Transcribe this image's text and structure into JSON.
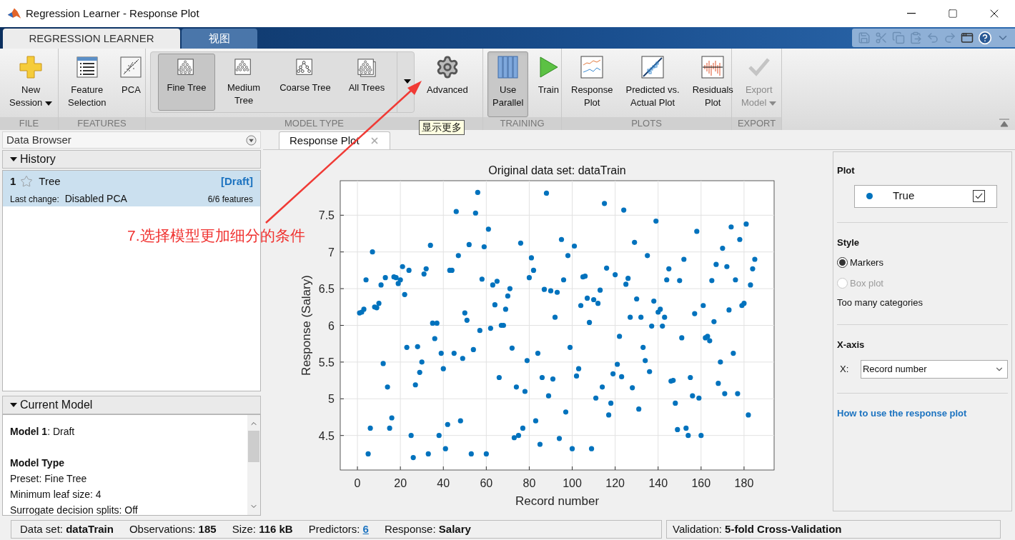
{
  "window": {
    "title": "Regression Learner - Response Plot"
  },
  "ribbon_tabs": [
    {
      "label": "REGRESSION LEARNER",
      "selected": true
    },
    {
      "label": "视图",
      "selected": false
    }
  ],
  "ribbon": {
    "groups": [
      {
        "label": "FILE",
        "items": [
          {
            "label": "New\nSession",
            "dropdown": true
          }
        ]
      },
      {
        "label": "FEATURES",
        "items": [
          {
            "label": "Feature\nSelection"
          },
          {
            "label": "PCA"
          }
        ]
      },
      {
        "label": "MODEL TYPE",
        "gallery": [
          {
            "label": "Fine Tree",
            "selected": true
          },
          {
            "label": "Medium\nTree",
            "selected": false
          },
          {
            "label": "Coarse Tree",
            "selected": false
          },
          {
            "label": "All Trees",
            "selected": false
          }
        ],
        "items": [
          {
            "label": "Advanced"
          }
        ]
      },
      {
        "label": "TRAINING",
        "items": [
          {
            "label": "Use\nParallel",
            "pressed": true
          },
          {
            "label": "Train",
            "pressed": false
          }
        ]
      },
      {
        "label": "PLOTS",
        "items": [
          {
            "label": "Response\nPlot"
          },
          {
            "label": "Predicted vs.\nActual Plot"
          },
          {
            "label": "Residuals\nPlot"
          }
        ]
      },
      {
        "label": "EXPORT",
        "items": [
          {
            "label": "Export\nModel",
            "dropdown": true,
            "disabled": true
          }
        ]
      }
    ]
  },
  "tooltip": {
    "text": "显示更多"
  },
  "annotation": {
    "text": "7.选择模型更加细分的条件"
  },
  "data_browser": {
    "title": "Data Browser",
    "history": {
      "title": "History",
      "expanded": true,
      "models": [
        {
          "number": "1",
          "starred": false,
          "name": "Tree",
          "status": "[Draft]",
          "last_change_label": "Last change:",
          "last_change": "Disabled PCA",
          "features": "6/6 features",
          "selected": true
        }
      ]
    },
    "current_model": {
      "title": "Current Model",
      "expanded": true,
      "lines": [
        {
          "kind": "text",
          "text": "**Model 1**: Draft"
        },
        {
          "kind": "heading",
          "text": "Model Type"
        },
        {
          "kind": "text",
          "text": "Preset: Fine Tree"
        },
        {
          "kind": "text",
          "text": "Minimum leaf size: 4"
        },
        {
          "kind": "text",
          "text": "Surrogate decision splits: Off"
        }
      ]
    }
  },
  "doc_tabs": [
    {
      "label": "Response Plot",
      "selected": true
    }
  ],
  "chart_data": {
    "type": "scatter",
    "grid": true,
    "title": "Original data set: dataTrain",
    "xlabel": "Record number",
    "ylabel": "Response (Salary)",
    "xlim": [
      -8,
      194
    ],
    "ylim": [
      4.03,
      7.97
    ],
    "xticks": [
      0,
      20,
      40,
      60,
      80,
      100,
      120,
      140,
      160,
      180
    ],
    "yticks": [
      4.5,
      5,
      5.5,
      6,
      6.5,
      7,
      7.5
    ],
    "x": [
      1,
      2,
      3,
      4,
      5,
      6,
      7,
      8,
      9,
      10,
      11,
      12,
      13,
      14,
      15,
      16,
      17,
      18,
      19,
      20,
      21,
      22,
      23,
      24,
      25,
      26,
      27,
      28,
      29,
      30,
      31,
      32,
      33,
      34,
      35,
      36,
      37,
      38,
      39,
      40,
      41,
      42,
      43,
      44,
      45,
      46,
      47,
      48,
      49,
      50,
      51,
      52,
      53,
      54,
      55,
      56,
      57,
      58,
      59,
      60,
      61,
      62,
      63,
      64,
      65,
      66,
      67,
      68,
      69,
      70,
      71,
      72,
      73,
      74,
      75,
      76,
      77,
      78,
      79,
      80,
      81,
      82,
      83,
      84,
      85,
      86,
      87,
      88,
      89,
      90,
      91,
      92,
      93,
      94,
      95,
      96,
      97,
      98,
      99,
      100,
      101,
      102,
      103,
      104,
      105,
      106,
      107,
      108,
      109,
      110,
      111,
      112,
      113,
      114,
      115,
      116,
      117,
      118,
      119,
      120,
      121,
      122,
      123,
      124,
      125,
      126,
      127,
      128,
      129,
      130,
      131,
      132,
      133,
      134,
      135,
      136,
      137,
      138,
      139,
      140,
      141,
      142,
      143,
      144,
      145,
      146,
      147,
      148,
      149,
      150,
      151,
      152,
      153,
      154,
      155,
      156,
      157,
      158,
      159,
      160,
      161,
      162,
      163,
      164,
      165,
      166,
      167,
      168,
      169,
      170,
      171,
      172,
      173,
      174,
      175,
      176,
      177,
      178,
      179,
      180,
      181,
      182,
      183,
      184,
      185
    ],
    "series": [
      {
        "name": "True",
        "color": "#0072bd",
        "values": [
          6.17,
          6.18,
          6.22,
          6.62,
          4.25,
          4.6,
          7.0,
          6.25,
          6.24,
          6.3,
          6.55,
          5.48,
          6.65,
          5.16,
          4.6,
          4.74,
          6.66,
          6.65,
          6.57,
          6.62,
          6.8,
          6.42,
          5.7,
          6.75,
          4.5,
          4.2,
          5.19,
          5.71,
          5.36,
          5.5,
          6.7,
          6.77,
          4.25,
          7.09,
          6.03,
          5.82,
          6.03,
          4.5,
          5.62,
          5.41,
          4.32,
          4.65,
          6.75,
          6.75,
          5.62,
          7.55,
          6.95,
          4.7,
          5.55,
          6.17,
          6.07,
          7.1,
          4.25,
          5.67,
          7.53,
          7.81,
          5.93,
          6.63,
          7.07,
          4.25,
          7.31,
          5.96,
          6.55,
          6.28,
          6.6,
          5.29,
          6.0,
          6.0,
          6.22,
          6.4,
          6.5,
          5.69,
          4.47,
          5.16,
          4.5,
          7.12,
          4.6,
          5.1,
          5.52,
          6.65,
          6.92,
          6.75,
          4.7,
          5.62,
          4.38,
          5.29,
          6.49,
          7.8,
          5.04,
          6.47,
          5.27,
          6.11,
          6.45,
          4.46,
          7.17,
          6.62,
          4.82,
          6.95,
          5.7,
          4.32,
          7.08,
          5.31,
          5.41,
          6.27,
          6.66,
          6.67,
          6.37,
          6.04,
          4.32,
          6.35,
          5.01,
          6.3,
          6.48,
          5.16,
          7.66,
          6.78,
          4.78,
          4.94,
          5.34,
          6.69,
          5.47,
          5.85,
          5.3,
          7.57,
          6.56,
          6.64,
          6.11,
          5.15,
          7.13,
          6.36,
          4.86,
          6.11,
          5.7,
          5.52,
          6.95,
          5.37,
          5.99,
          6.33,
          7.42,
          6.18,
          6.22,
          5.99,
          6.11,
          6.62,
          6.77,
          5.24,
          5.25,
          4.94,
          4.58,
          6.61,
          5.83,
          6.9,
          4.6,
          4.5,
          5.29,
          5.04,
          6.16,
          7.28,
          5.01,
          4.5,
          6.27,
          5.83,
          5.85,
          5.79,
          6.61,
          6.05,
          6.83,
          5.21,
          5.5,
          7.05,
          5.07,
          6.8,
          6.21,
          7.34,
          5.62,
          6.62,
          5.07,
          7.17,
          6.27,
          6.3,
          7.38,
          4.78,
          6.55,
          6.77,
          6.9
        ]
      }
    ]
  },
  "options": {
    "plot": {
      "title": "Plot",
      "checked": true
    },
    "style": {
      "title": "Style",
      "options": [
        {
          "label": "Markers",
          "selected": true,
          "disabled": false
        },
        {
          "label": "Box plot",
          "selected": false,
          "disabled": true
        }
      ],
      "note": "Too many categories"
    },
    "x_axis": {
      "title": "X-axis",
      "field_label": "X:",
      "value": "Record number"
    },
    "help_link": "How to use the response plot"
  },
  "status_bar": {
    "items": [
      {
        "label": "Data set: ",
        "value": "dataTrain",
        "kind": "bold"
      },
      {
        "label": "Observations: ",
        "value": "185",
        "kind": "bold"
      },
      {
        "label": "Size: ",
        "value": "116 kB",
        "kind": "bold"
      },
      {
        "label": "Predictors: ",
        "value": "6",
        "kind": "link"
      },
      {
        "label": "Response: ",
        "value": "Salary",
        "kind": "bold"
      }
    ],
    "validation": {
      "label": "Validation: ",
      "value": "5-fold Cross-Validation"
    }
  }
}
